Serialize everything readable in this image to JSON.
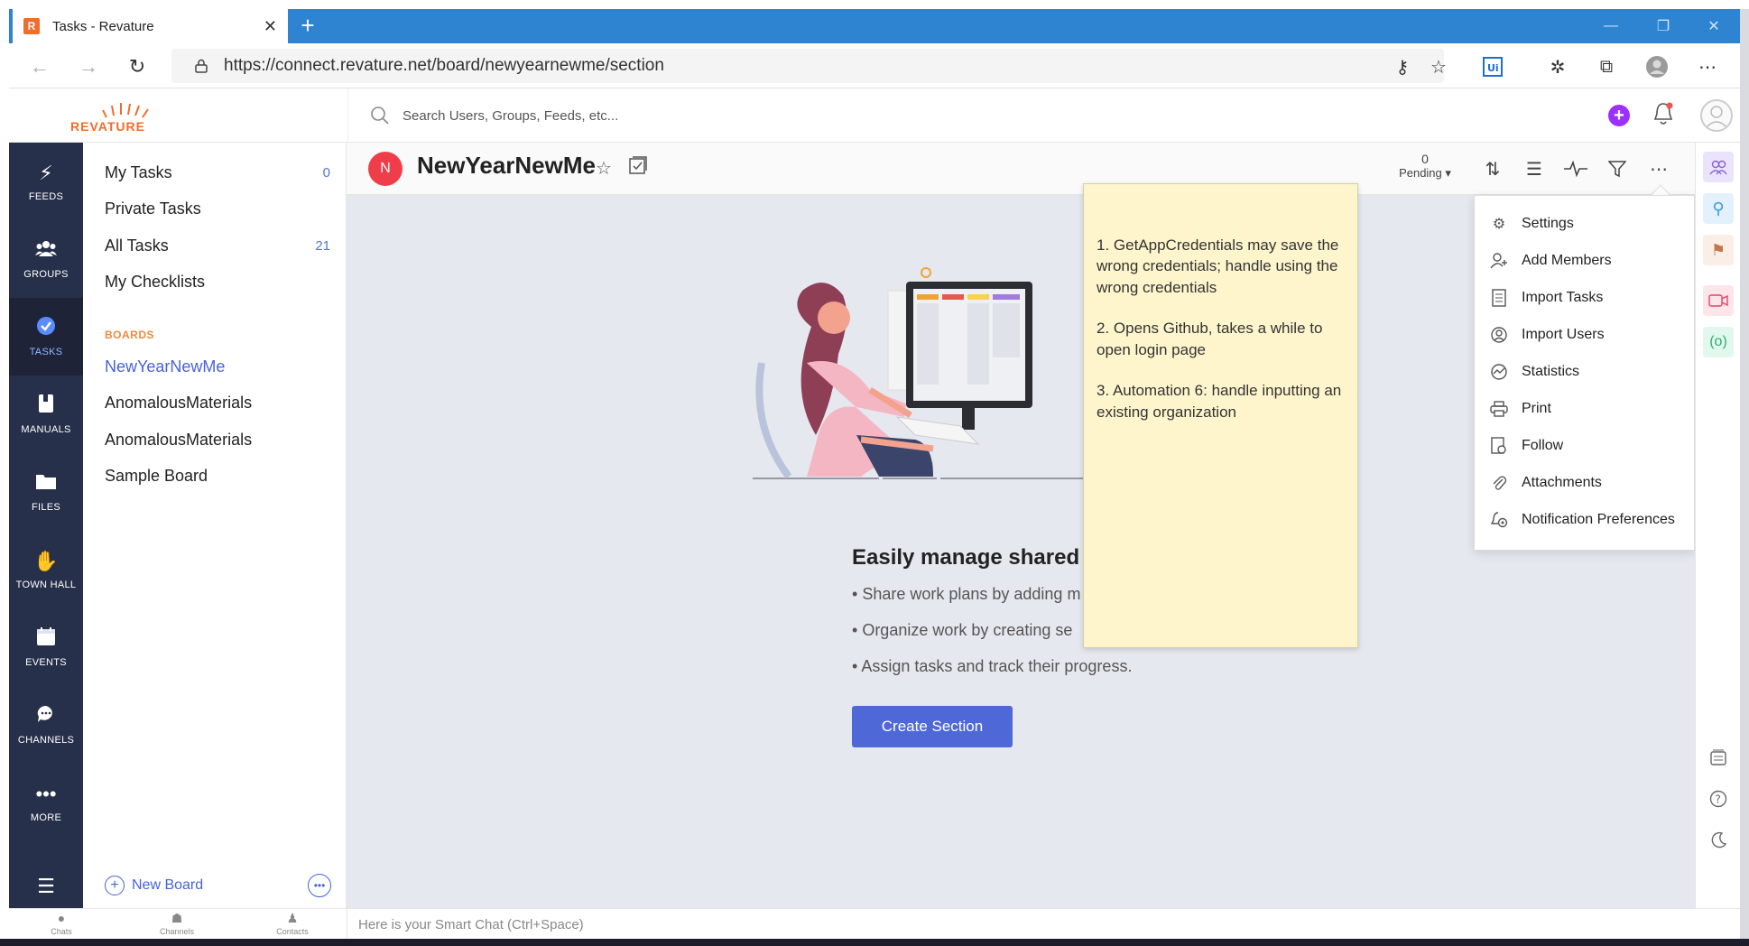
{
  "browser": {
    "tab_title": "Tasks - Revature",
    "favicon_letter": "R",
    "url": "https://connect.revature.net/board/newyearnewme/section"
  },
  "header": {
    "logo_text": "REVATURE",
    "search_placeholder": "Search Users, Groups, Feeds, etc...",
    "add_label": "+"
  },
  "rail": {
    "items": [
      {
        "label": "FEEDS",
        "icon": "bolt-icon"
      },
      {
        "label": "GROUPS",
        "icon": "groups-icon"
      },
      {
        "label": "TASKS",
        "icon": "check-circle-icon",
        "active": true
      },
      {
        "label": "MANUALS",
        "icon": "manual-icon"
      },
      {
        "label": "FILES",
        "icon": "folder-icon"
      },
      {
        "label": "TOWN HALL",
        "icon": "hand-icon"
      },
      {
        "label": "EVENTS",
        "icon": "calendar-icon"
      },
      {
        "label": "CHANNELS",
        "icon": "chat-icon"
      },
      {
        "label": "MORE",
        "icon": "more-icon"
      }
    ]
  },
  "tasknav": {
    "items": [
      {
        "label": "My Tasks",
        "count": "0"
      },
      {
        "label": "Private Tasks",
        "count": ""
      },
      {
        "label": "All Tasks",
        "count": "21"
      },
      {
        "label": "My Checklists",
        "count": ""
      }
    ],
    "boards_label": "BOARDS",
    "boards": [
      {
        "label": "NewYearNewMe",
        "active": true
      },
      {
        "label": "AnomalousMaterials"
      },
      {
        "label": "AnomalousMaterials"
      },
      {
        "label": "Sample Board"
      }
    ],
    "new_board_label": "New Board"
  },
  "board": {
    "avatar_letter": "N",
    "title": "NewYearNewMe",
    "pending_count": "0",
    "pending_label": "Pending"
  },
  "empty_state": {
    "title": "Easily manage shared w",
    "bullets": [
      "Share work plans by adding m",
      "Organize work by creating se",
      "Assign tasks and track their progress."
    ],
    "button_label": "Create Section"
  },
  "sticky_note": {
    "lines": [
      "1. GetAppCredentials may save the wrong credentials; handle using the wrong credentials",
      "2. Opens Github, takes a while to open login page",
      "3. Automation 6: handle inputting an existing organization"
    ]
  },
  "menu": {
    "items": [
      {
        "label": "Settings",
        "icon": "gear-icon"
      },
      {
        "label": "Add Members",
        "icon": "add-member-icon"
      },
      {
        "label": "Import Tasks",
        "icon": "import-tasks-icon"
      },
      {
        "label": "Import Users",
        "icon": "import-users-icon"
      },
      {
        "label": "Statistics",
        "icon": "statistics-icon"
      },
      {
        "label": "Print",
        "icon": "print-icon"
      },
      {
        "label": "Follow",
        "icon": "follow-icon"
      },
      {
        "label": "Attachments",
        "icon": "attachment-icon"
      },
      {
        "label": "Notification Preferences",
        "icon": "notification-prefs-icon"
      }
    ]
  },
  "bottombar": {
    "chats": "Chats",
    "channels": "Channels",
    "contacts": "Contacts",
    "smartchat_placeholder": "Here is your Smart Chat (Ctrl+Space)"
  },
  "colors": {
    "accent": "#4f68d8",
    "brand_orange": "#f26c2b",
    "rail_bg": "#27304a",
    "sticky_bg": "#fff5cc",
    "board_avatar": "#ef3e4a"
  }
}
